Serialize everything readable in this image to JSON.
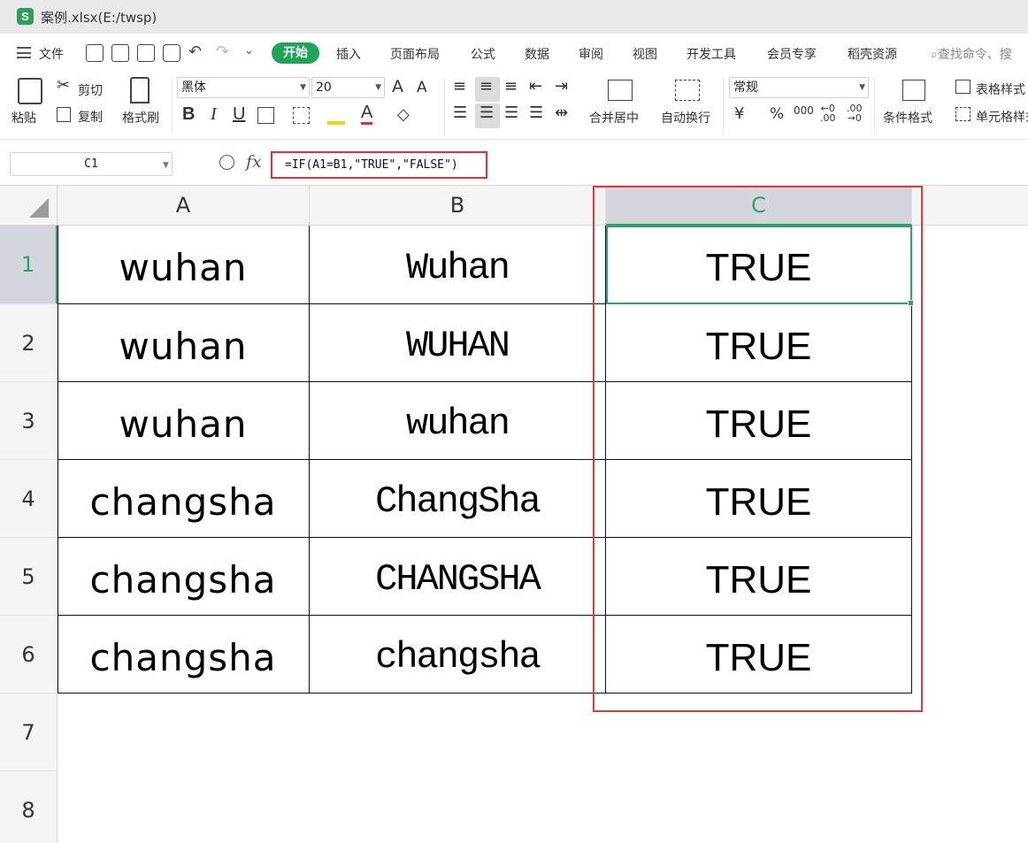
{
  "window": {
    "title": "案例.xlsx(E:/twsp)",
    "logo": "S"
  },
  "menu": {
    "file_label": "文件",
    "tabs": [
      "开始",
      "插入",
      "页面布局",
      "公式",
      "数据",
      "审阅",
      "视图",
      "开发工具",
      "会员专享",
      "稻壳资源"
    ],
    "active_tab": "开始",
    "search_placeholder": "查找命令、搜"
  },
  "ribbon": {
    "paste": "粘贴",
    "cut": "剪切",
    "copy": "复制",
    "format_painter": "格式刷",
    "font_name": "黑体",
    "font_size": "20",
    "bold": "B",
    "italic": "I",
    "underline": "U",
    "merge_center": "合并居中",
    "wrap_text": "自动换行",
    "number_format": "常规",
    "currency": "¥",
    "percent": "%",
    "thousands": "000",
    "conditional_format": "条件格式",
    "table_style": "表格样式",
    "cell_style": "单元格样式"
  },
  "formula_bar": {
    "name_box": "C1",
    "fx": "fx",
    "formula": "=IF(A1=B1,\"TRUE\",\"FALSE\")"
  },
  "sheet": {
    "columns": [
      "A",
      "B",
      "C"
    ],
    "selected_column": "C",
    "row_numbers": [
      "1",
      "2",
      "3",
      "4",
      "5",
      "6",
      "7",
      "8"
    ],
    "selected_row": "1",
    "rows": [
      [
        "wuhan",
        "Wuhan",
        "TRUE"
      ],
      [
        "wuhan",
        "WUHAN",
        "TRUE"
      ],
      [
        "wuhan",
        "wuhan",
        "TRUE"
      ],
      [
        "changsha",
        "ChangSha",
        "TRUE"
      ],
      [
        "changsha",
        "CHANGSHA",
        "TRUE"
      ],
      [
        "changsha",
        "changsha",
        "TRUE"
      ]
    ]
  },
  "colors": {
    "accent": "#20a45a",
    "highlight_box": "#e23a3a",
    "selection": "#2ba36a"
  }
}
